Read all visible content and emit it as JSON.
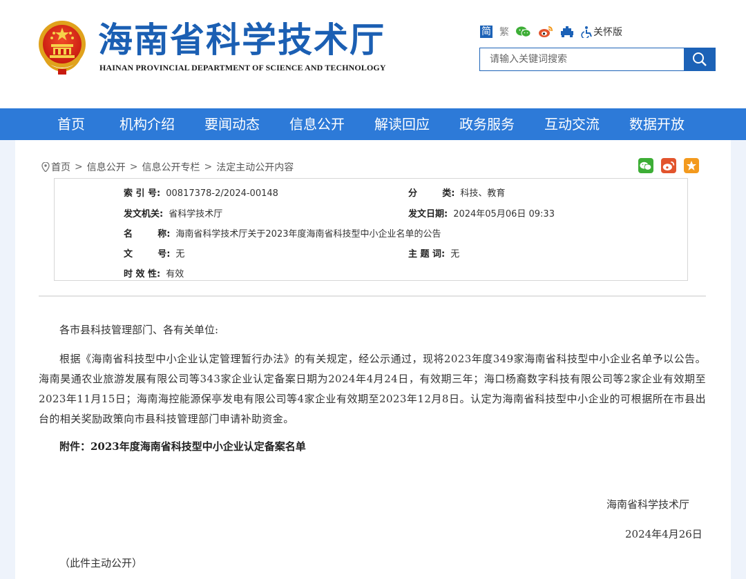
{
  "header": {
    "site_title": "海南省科学技术厅",
    "site_subtitle": "HAINAN PROVINCIAL DEPARTMENT OF SCIENCE AND TECHNOLOGY",
    "util": {
      "simplified": "简",
      "traditional": "繁",
      "elderly_mode": "关怀版"
    },
    "search": {
      "placeholder": "请输入关键词搜索"
    }
  },
  "nav": {
    "items": [
      "首页",
      "机构介绍",
      "要闻动态",
      "信息公开",
      "解读回应",
      "政务服务",
      "互动交流",
      "数据开放"
    ]
  },
  "breadcrumb": {
    "items": [
      "首页",
      "信息公开",
      "信息公开专栏",
      "法定主动公开内容"
    ],
    "separator": ">"
  },
  "meta": {
    "index_label": "索 引 号:",
    "index_value": "00817378-2/2024-00148",
    "category_label": "分        类:",
    "category_value": "科技、教育",
    "issuer_label": "发文机关:",
    "issuer_value": "省科学技术厅",
    "date_label": "发文日期:",
    "date_value": "2024年05月06日 09:33",
    "name_label": "名        称:",
    "name_value": "海南省科学技术厅关于2023年度海南省科技型中小企业名单的公告",
    "docno_label": "文        号:",
    "docno_value": "无",
    "keywords_label": "主 题 词:",
    "keywords_value": "无",
    "validity_label": "时 效 性:",
    "validity_value": "有效"
  },
  "article": {
    "salutation": "各市县科技管理部门、各有关单位:",
    "paragraph": "根据《海南省科技型中小企业认定管理暂行办法》的有关规定，经公示通过，现将2023年度349家海南省科技型中小企业名单予以公告。海南昊通农业旅游发展有限公司等343家企业认定备案日期为2024年4月24日，有效期三年；海口杨裔数字科技有限公司等2家企业有效期至2023年11月15日；海南海控能源保亭发电有限公司等4家企业有效期至2023年12月8日。认定为海南省科技型中小企业的可根据所在市县出台的相关奖励政策向市县科技管理部门申请补助资金。",
    "attachment": "附件：2023年度海南省科技型中小企业认定备案名单",
    "signature": "海南省科学技术厅",
    "date": "2024年4月26日",
    "note": "（此件主动公开）"
  },
  "colors": {
    "brand_blue": "#1b5fb3",
    "nav_blue": "#2d7ad8",
    "wechat_green": "#3dae36",
    "weibo_red": "#e2542d",
    "favorite_orange": "#f39a1e"
  },
  "icons": {
    "emblem": "national-emblem",
    "wechat": "wechat-icon",
    "weibo": "weibo-icon",
    "accessibility": "accessibility-icon",
    "search": "search-icon",
    "location": "location-pin-icon",
    "favorite": "star-icon"
  }
}
